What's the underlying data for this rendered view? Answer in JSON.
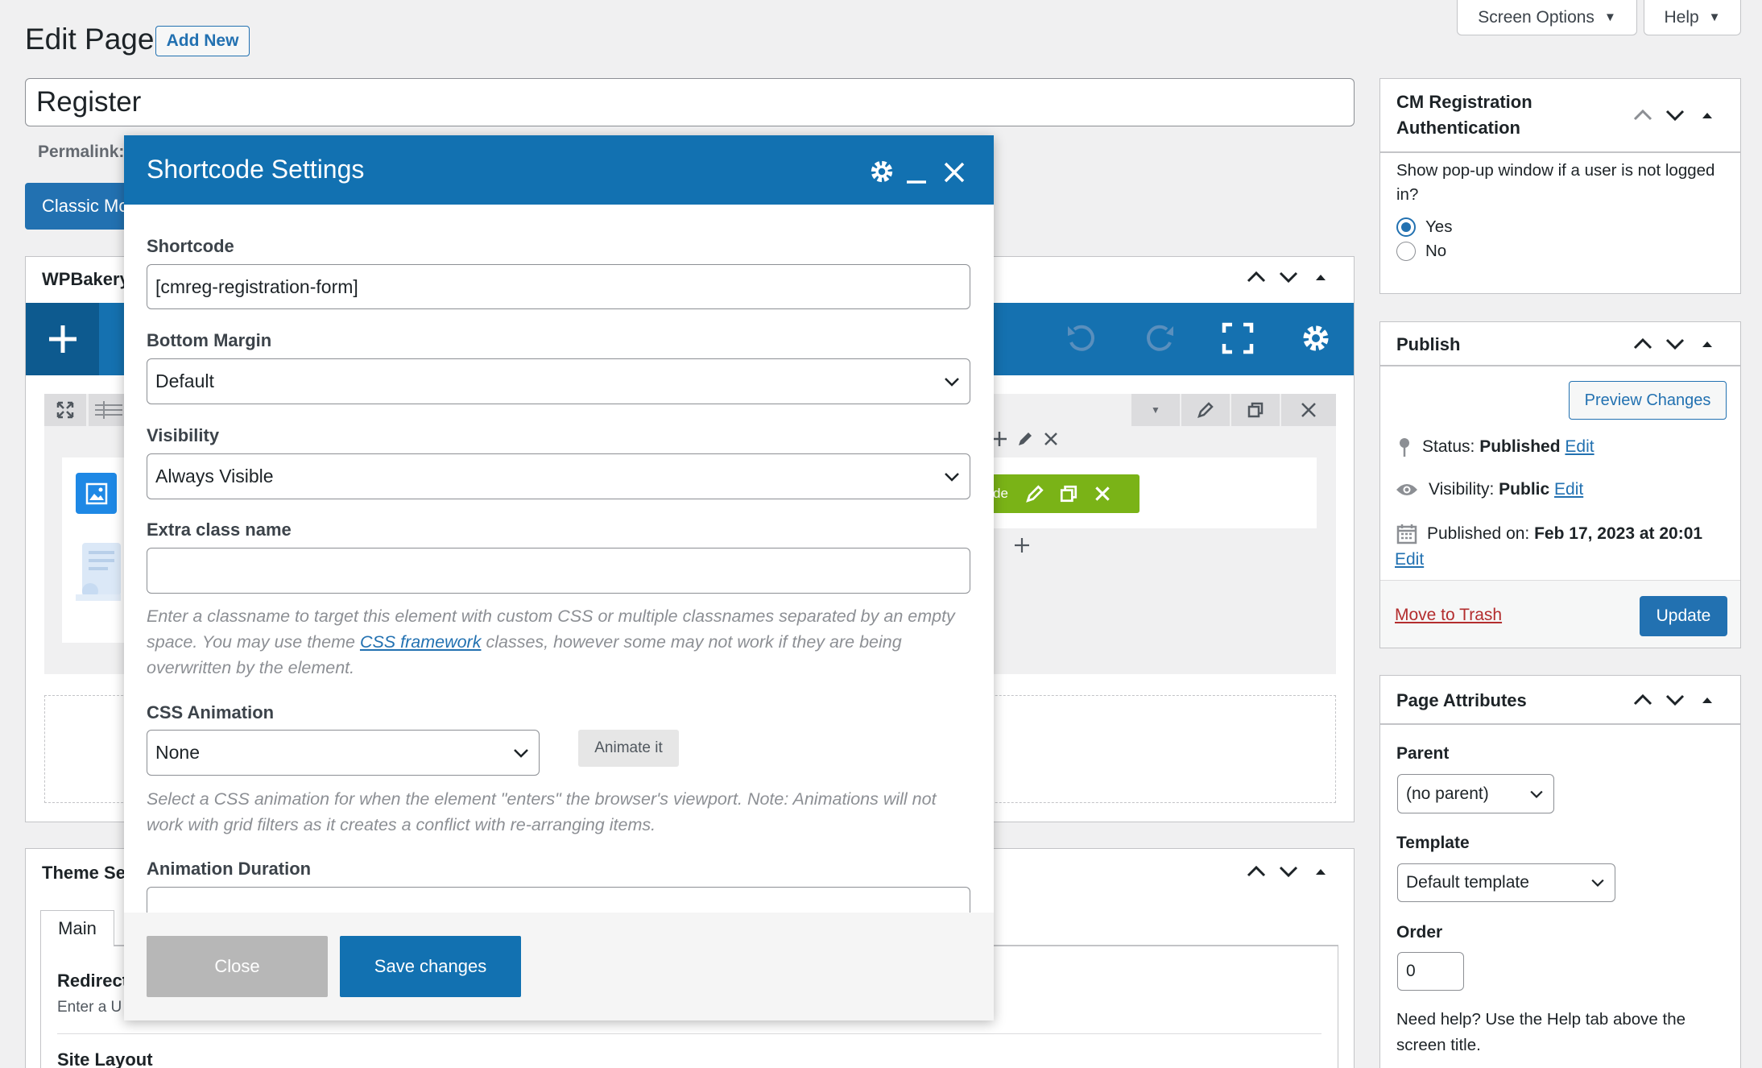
{
  "header": {
    "title": "Edit Page",
    "add_new": "Add New",
    "screen_options": "Screen Options",
    "help": "Help"
  },
  "title_field": {
    "value": "Register"
  },
  "permalink_label": "Permalink:",
  "classic_mode_partial": "Classic Mo",
  "wpbakery": {
    "title_partial": "WPBakery",
    "element_button_partial": "de"
  },
  "theme_settings": {
    "title_partial": "Theme Se",
    "tab_main": "Main",
    "redirect_partial": "Redirect",
    "redirect_help_partial": "Enter a U",
    "site_layout": "Site Layout"
  },
  "modal": {
    "title": "Shortcode Settings",
    "shortcode_label": "Shortcode",
    "shortcode_value": "[cmreg-registration-form]",
    "bottom_margin_label": "Bottom Margin",
    "bottom_margin_value": "Default",
    "visibility_label": "Visibility",
    "visibility_value": "Always Visible",
    "extra_class_label": "Extra class name",
    "extra_class_value": "",
    "extra_class_help_1": "Enter a classname to target this element with custom CSS or multiple classnames separated by an empty space. You may use theme ",
    "extra_class_help_link": "CSS framework",
    "extra_class_help_2": " classes, however some may not work if they are being overwritten by the element.",
    "css_animation_label": "CSS Animation",
    "css_animation_value": "None",
    "animate_button": "Animate it",
    "css_animation_help": "Select a CSS animation for when the element \"enters\" the browser's viewport. Note: Animations will not work with grid filters as it creates a conflict with re-arranging items.",
    "animation_duration_label": "Animation Duration",
    "close_button": "Close",
    "save_button": "Save changes"
  },
  "cm_box": {
    "title_line1": "CM Registration",
    "title_line2": "Authentication",
    "question": "Show pop-up window if a user is not logged in?",
    "options": [
      {
        "label": "Yes",
        "checked": true
      },
      {
        "label": "No",
        "checked": false
      }
    ]
  },
  "publish": {
    "title": "Publish",
    "preview_button": "Preview Changes",
    "status_label": "Status:",
    "status_value": "Published",
    "visibility_label": "Visibility:",
    "visibility_value": "Public",
    "published_on_label": "Published on:",
    "published_on_value": "Feb 17, 2023 at 20:01",
    "edit": "Edit",
    "trash": "Move to Trash",
    "update": "Update"
  },
  "page_attributes": {
    "title": "Page Attributes",
    "parent_label": "Parent",
    "parent_value": "(no parent)",
    "template_label": "Template",
    "template_value": "Default template",
    "order_label": "Order",
    "order_value": "0",
    "help_text": "Need help? Use the Help tab above the screen title."
  },
  "colors": {
    "wp_blue": "#2271b1",
    "modal_header": "#1271b1",
    "vc_green": "#7ab317",
    "trash_red": "#b32d2e"
  }
}
